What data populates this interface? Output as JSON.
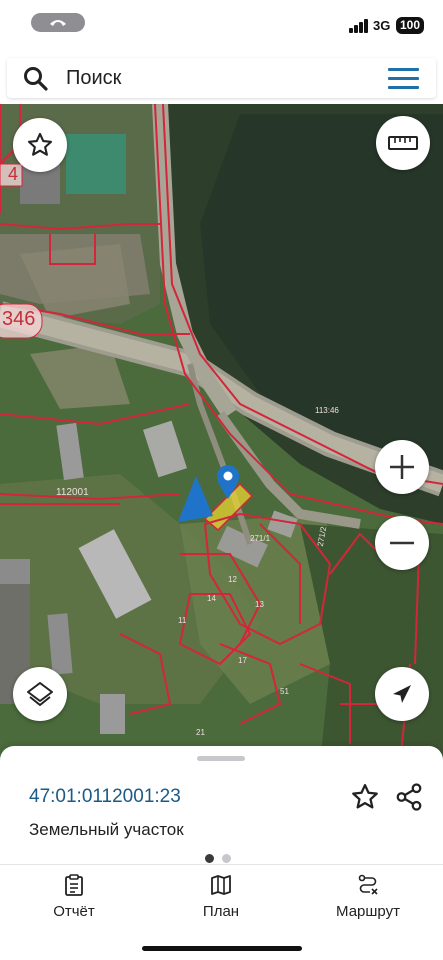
{
  "status_bar": {
    "network": "3G",
    "battery": "100"
  },
  "search": {
    "placeholder": "Поиск"
  },
  "map": {
    "labels": [
      "346",
      "112001",
      "113:46",
      "271/1",
      "271/2",
      "14",
      "12",
      "13",
      "17",
      "21",
      "11",
      "4",
      "51"
    ]
  },
  "parcel": {
    "cadastral_number": "47:01:0112001:23",
    "type": "Земельный участок"
  },
  "tabs": [
    {
      "label": "Отчёт",
      "icon": "clipboard-icon"
    },
    {
      "label": "План",
      "icon": "map-icon"
    },
    {
      "label": "Маршрут",
      "icon": "route-icon"
    }
  ],
  "colors": {
    "accent": "#1f6fa8",
    "cadastral_line": "#d3263a",
    "marker": "#1f74c9"
  }
}
